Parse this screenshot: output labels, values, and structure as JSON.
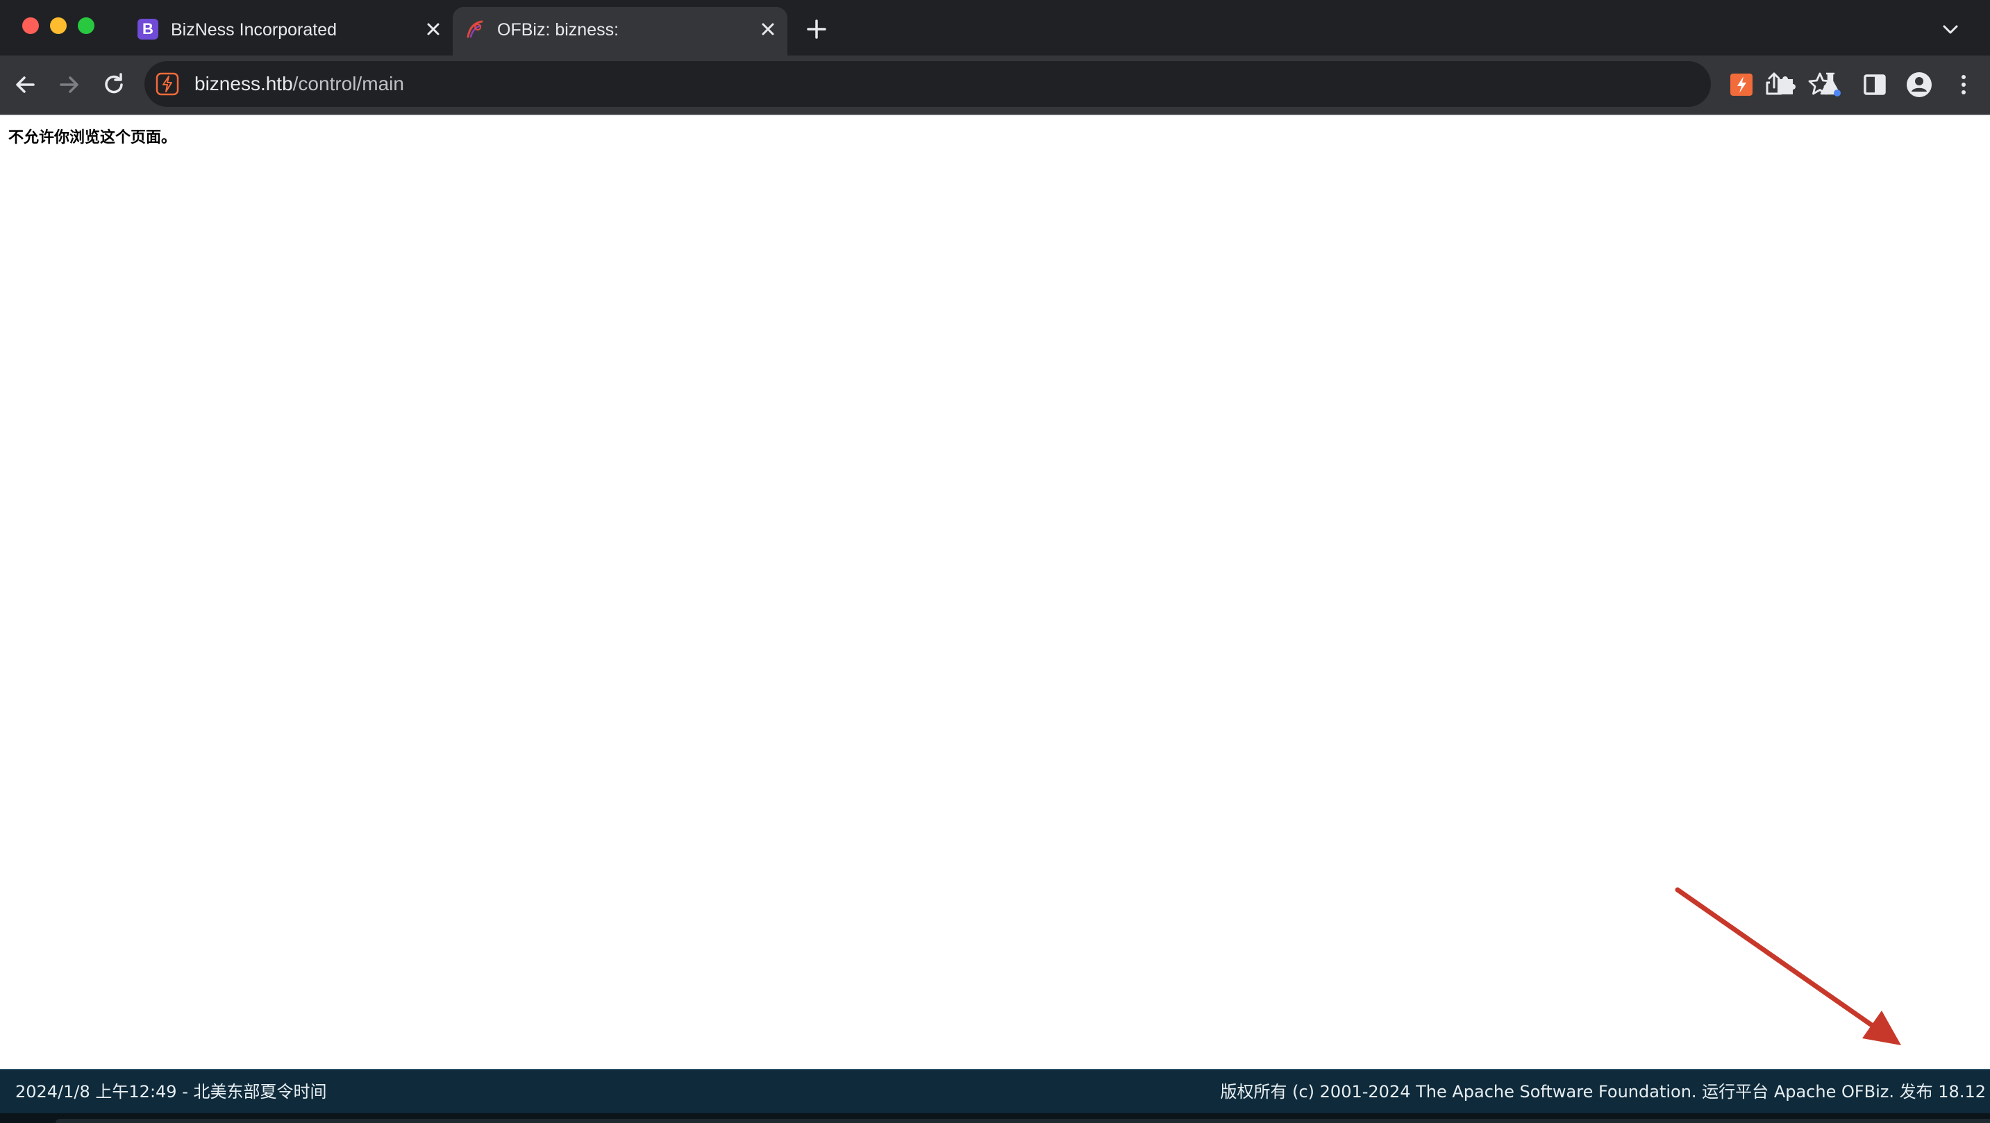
{
  "browser": {
    "tabs": [
      {
        "title": "BizNess Incorporated",
        "favicon_letter": "B",
        "active": false
      },
      {
        "title": "OFBiz: bizness:",
        "active": true
      }
    ],
    "url_host": "bizness.htb",
    "url_path": "/control/main"
  },
  "page": {
    "message": "不允许你浏览这个页面。"
  },
  "footer": {
    "left": "2024/1/8 上午12:49 - 北美东部夏令时间",
    "right": "版权所有 (c) 2001-2024 The Apache Software Foundation. 运行平台 Apache OFBiz. 发布 18.12"
  },
  "colors": {
    "tabstrip": "#202124",
    "toolbar": "#35363a",
    "footer": "#0f2a3a",
    "annotation_arrow": "#c8382a",
    "extension_accent": "#f26b3a"
  },
  "icons": {
    "back": "arrow-left-icon",
    "forward": "arrow-right-icon",
    "reload": "reload-icon",
    "share": "share-icon",
    "bookmark": "star-icon",
    "extensions": "puzzle-icon",
    "labs": "flask-icon",
    "side_panel": "side-panel-icon",
    "profile": "person-icon",
    "menu": "kebab-menu-icon"
  }
}
